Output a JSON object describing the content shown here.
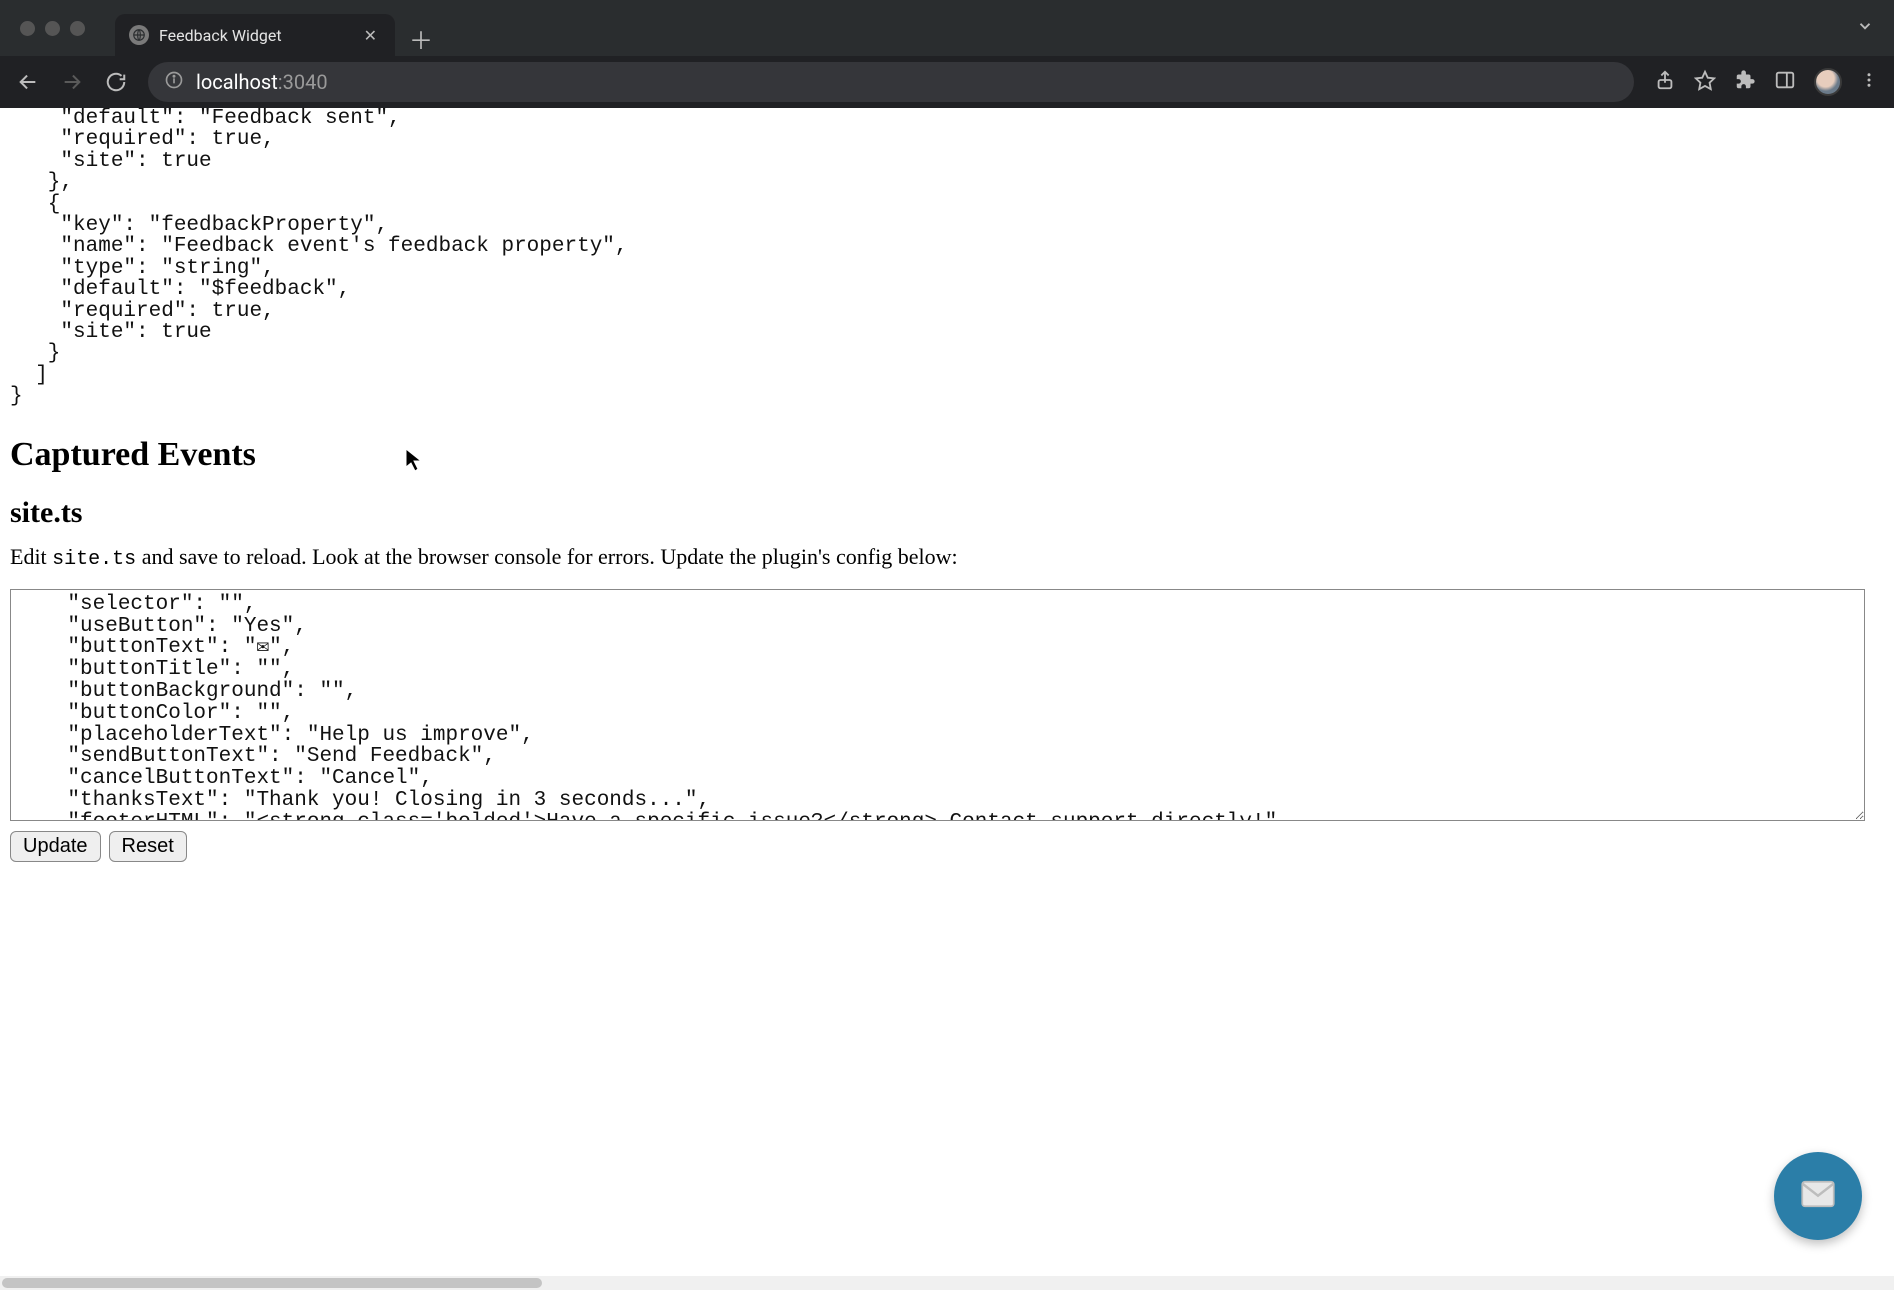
{
  "browser": {
    "tab_title": "Feedback Widget",
    "url_host": "localhost",
    "url_path": ":3040"
  },
  "code_top": "    \"default\": \"Feedback sent\",\n    \"required\": true,\n    \"site\": true\n   },\n   {\n    \"key\": \"feedbackProperty\",\n    \"name\": \"Feedback event's feedback property\",\n    \"type\": \"string\",\n    \"default\": \"$feedback\",\n    \"required\": true,\n    \"site\": true\n   }\n  ]\n}",
  "heading_captured": "Captured Events",
  "heading_site": "site.ts",
  "instr_prefix": "Edit ",
  "instr_code": "site.ts",
  "instr_suffix": " and save to reload. Look at the browser console for errors. Update the plugin's config below:",
  "config_text": "    \"selector\": \"\",\n    \"useButton\": \"Yes\",\n    \"buttonText\": \"✉\",\n    \"buttonTitle\": \"\",\n    \"buttonBackground\": \"\",\n    \"buttonColor\": \"\",\n    \"placeholderText\": \"Help us improve\",\n    \"sendButtonText\": \"Send Feedback\",\n    \"cancelButtonText\": \"Cancel\",\n    \"thanksText\": \"Thank you! Closing in 3 seconds...\",\n    \"footerHTML\": \"<strong class='bolded'>Have a specific issue?</strong> Contact support directly!\",",
  "buttons": {
    "update": "Update",
    "reset": "Reset"
  }
}
